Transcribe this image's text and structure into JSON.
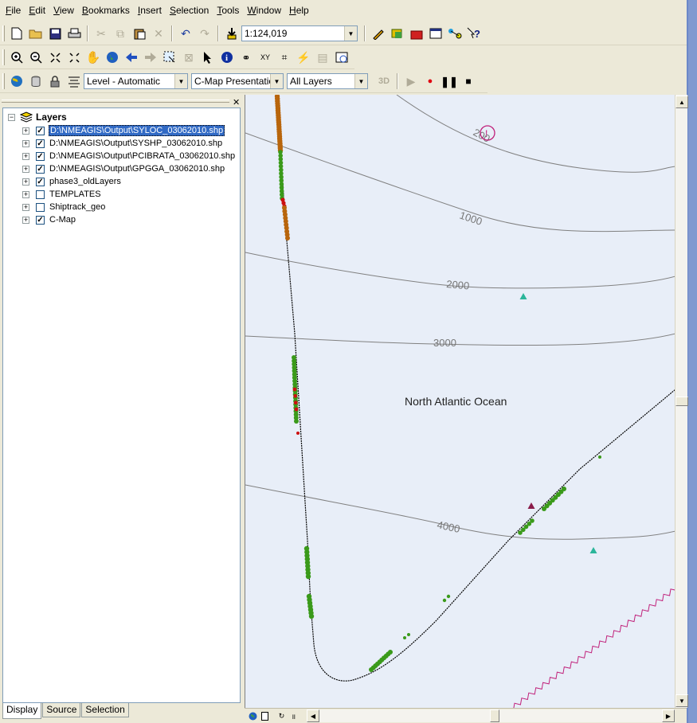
{
  "menu": {
    "items": [
      {
        "label": "File",
        "u": "F",
        "rest": "ile"
      },
      {
        "label": "Edit",
        "u": "E",
        "rest": "dit"
      },
      {
        "label": "View",
        "u": "V",
        "rest": "iew"
      },
      {
        "label": "Bookmarks",
        "u": "B",
        "rest": "ookmarks"
      },
      {
        "label": "Insert",
        "u": "I",
        "rest": "nsert"
      },
      {
        "label": "Selection",
        "u": "S",
        "rest": "election"
      },
      {
        "label": "Tools",
        "u": "T",
        "rest": "ools"
      },
      {
        "label": "Window",
        "u": "W",
        "rest": "indow"
      },
      {
        "label": "Help",
        "u": "H",
        "rest": "elp"
      }
    ]
  },
  "toolbar": {
    "scale": "1:124,019",
    "level": "Level - Automatic",
    "presentation": "C-Map Presentation",
    "layers_filter": "All Layers",
    "btn_3d": "3D"
  },
  "toc": {
    "root_label": "Layers",
    "layers": [
      {
        "label": "D:\\NMEAGIS\\Output\\SYLOC_03062010.shp",
        "checked": true,
        "selected": true
      },
      {
        "label": "D:\\NMEAGIS\\Output\\SYSHP_03062010.shp",
        "checked": true,
        "selected": false
      },
      {
        "label": "D:\\NMEAGIS\\Output\\PCIBRATA_03062010.shp",
        "checked": true,
        "selected": false
      },
      {
        "label": "D:\\NMEAGIS\\Output\\GPGGA_03062010.shp",
        "checked": true,
        "selected": false
      },
      {
        "label": "phase3_oldLayers",
        "checked": true,
        "selected": false
      },
      {
        "label": "TEMPLATES",
        "checked": false,
        "selected": false
      },
      {
        "label": "Shiptrack_geo",
        "checked": false,
        "selected": false
      },
      {
        "label": "C-Map",
        "checked": true,
        "selected": false
      }
    ],
    "tabs": [
      {
        "label": "Display",
        "active": true
      },
      {
        "label": "Source",
        "active": false
      },
      {
        "label": "Selection",
        "active": false
      }
    ]
  },
  "map": {
    "ocean_label": "North Atlantic Ocean",
    "contours": [
      "200",
      "1000",
      "2000",
      "3000",
      "4000"
    ],
    "colors": {
      "water": "#e8eef8",
      "contour": "#808080",
      "track": "#000000",
      "points_green": "#3a9a1a",
      "points_brown": "#b8650c",
      "points_red": "#cc1010",
      "triangle_teal": "#2bb59a",
      "triangle_maroon": "#8a1c4a",
      "boundary": "#c0207a"
    }
  }
}
